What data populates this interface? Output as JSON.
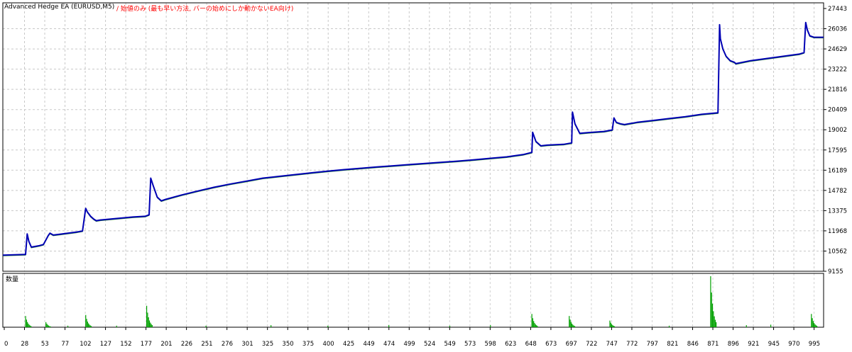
{
  "chart_data": [
    {
      "type": "line",
      "title": "Advanced Hedge EA (EURUSD,M5)",
      "subtitle": "/ 始値のみ (最も早い方法, バーの始めにしか動かないEA向け)",
      "ylim": [
        9155,
        27443
      ],
      "y_ticks": [
        "27443",
        "26036",
        "24629",
        "23222",
        "21816",
        "20409",
        "19002",
        "17595",
        "16189",
        "14782",
        "13375",
        "11968",
        "10562",
        "9155"
      ],
      "x_ticks": [
        "0",
        "28",
        "53",
        "77",
        "102",
        "127",
        "152",
        "177",
        "201",
        "226",
        "251",
        "276",
        "301",
        "325",
        "350",
        "375",
        "400",
        "425",
        "449",
        "474",
        "499",
        "524",
        "549",
        "573",
        "598",
        "623",
        "648",
        "673",
        "697",
        "722",
        "747",
        "772",
        "797",
        "821",
        "846",
        "871",
        "896",
        "921",
        "945",
        "970",
        "995"
      ],
      "grid": true,
      "xlim": [
        0,
        1010
      ],
      "series": [
        {
          "color": "#0000b4",
          "x": [
            0,
            28,
            30,
            32,
            35,
            40,
            45,
            50,
            56,
            58,
            62,
            70,
            80,
            90,
            98,
            102,
            104,
            108,
            112,
            115,
            120,
            140,
            160,
            175,
            180,
            182,
            185,
            190,
            195,
            200,
            220,
            240,
            260,
            280,
            300,
            320,
            340,
            360,
            380,
            400,
            420,
            440,
            460,
            480,
            500,
            520,
            540,
            560,
            580,
            600,
            620,
            640,
            651,
            652,
            656,
            662,
            670,
            690,
            700,
            701,
            704,
            710,
            720,
            740,
            750,
            752,
            755,
            760,
            765,
            780,
            800,
            820,
            840,
            860,
            880,
            882,
            883,
            886,
            890,
            895,
            900,
            902,
            920,
            940,
            960,
            980,
            986,
            988,
            990,
            993,
            998,
            1003,
            1010
          ],
          "y": [
            10250,
            10300,
            11700,
            11200,
            10800,
            10850,
            10900,
            10980,
            11600,
            11750,
            11620,
            11680,
            11750,
            11820,
            11900,
            13440,
            13200,
            12900,
            12700,
            12600,
            12650,
            12750,
            12850,
            12900,
            13000,
            15500,
            15000,
            14200,
            13950,
            14050,
            14350,
            14620,
            14880,
            15100,
            15300,
            15500,
            15620,
            15740,
            15860,
            15980,
            16080,
            16170,
            16260,
            16340,
            16420,
            16500,
            16580,
            16660,
            16750,
            16850,
            16950,
            17100,
            17250,
            18620,
            18000,
            17700,
            17750,
            17800,
            17900,
            20000,
            19200,
            18550,
            18600,
            18680,
            18780,
            19600,
            19300,
            19200,
            19150,
            19300,
            19430,
            19560,
            19690,
            19850,
            19950,
            25950,
            25000,
            24300,
            23800,
            23500,
            23400,
            23300,
            23500,
            23650,
            23800,
            23950,
            24050,
            26100,
            25600,
            25200,
            25100,
            25100,
            25100
          ]
        }
      ],
      "panel_label": "数量",
      "volume_spikes": [
        {
          "x": 28,
          "v": 0.22
        },
        {
          "x": 53,
          "v": 0.1
        },
        {
          "x": 102,
          "v": 0.24
        },
        {
          "x": 177,
          "v": 0.42
        },
        {
          "x": 651,
          "v": 0.26
        },
        {
          "x": 697,
          "v": 0.22
        },
        {
          "x": 747,
          "v": 0.13
        },
        {
          "x": 871,
          "v": 1.0
        },
        {
          "x": 995,
          "v": 0.26
        }
      ],
      "volume_small": [
        {
          "x": 80,
          "v": 0.03
        },
        {
          "x": 140,
          "v": 0.03
        },
        {
          "x": 250,
          "v": 0.03
        },
        {
          "x": 330,
          "v": 0.04
        },
        {
          "x": 400,
          "v": 0.03
        },
        {
          "x": 475,
          "v": 0.04
        },
        {
          "x": 550,
          "v": 0.03
        },
        {
          "x": 600,
          "v": 0.04
        },
        {
          "x": 820,
          "v": 0.03
        },
        {
          "x": 915,
          "v": 0.04
        },
        {
          "x": 945,
          "v": 0.05
        }
      ]
    }
  ]
}
